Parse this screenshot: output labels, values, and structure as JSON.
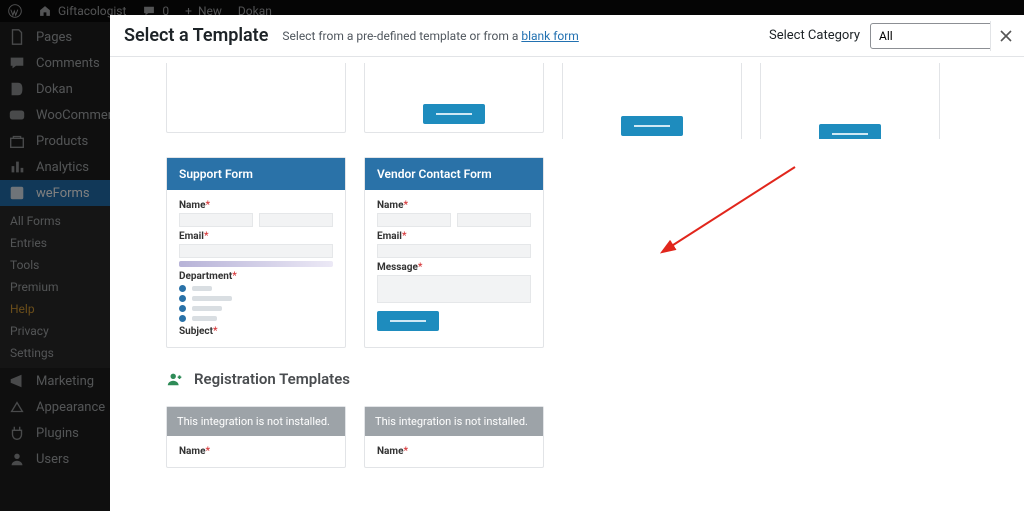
{
  "adminbar": {
    "site_name": "Giftacologist",
    "comments_count": "0",
    "new_label": "New",
    "dokan_label": "Dokan"
  },
  "sidebar": {
    "items": [
      {
        "label": "Pages",
        "icon": "pages"
      },
      {
        "label": "Comments",
        "icon": "comments"
      },
      {
        "label": "Dokan",
        "icon": "dokan"
      },
      {
        "label": "WooCommerce",
        "icon": "woo"
      },
      {
        "label": "Products",
        "icon": "products"
      },
      {
        "label": "Analytics",
        "icon": "analytics"
      },
      {
        "label": "weForms",
        "icon": "weforms"
      },
      {
        "label": "Marketing",
        "icon": "marketing"
      },
      {
        "label": "Appearance",
        "icon": "appearance"
      },
      {
        "label": "Plugins",
        "icon": "plugins"
      },
      {
        "label": "Users",
        "icon": "users"
      }
    ],
    "subitems": [
      {
        "label": "All Forms"
      },
      {
        "label": "Entries"
      },
      {
        "label": "Tools"
      },
      {
        "label": "Premium"
      },
      {
        "label": "Help",
        "help": true
      },
      {
        "label": "Privacy"
      },
      {
        "label": "Settings"
      }
    ]
  },
  "modal": {
    "title": "Select a Template",
    "subtitle_pre": "Select from a pre-defined template or from a ",
    "blank_link": "blank form",
    "category_label": "Select Category",
    "category_value": "All",
    "section_reg": "Registration Templates",
    "not_installed": "This integration is not installed."
  },
  "cards": {
    "support": {
      "title": "Support Form",
      "name_label": "Name",
      "email_label": "Email",
      "dept_label": "Department",
      "subject_label": "Subject"
    },
    "vendor": {
      "title": "Vendor Contact Form",
      "name_label": "Name",
      "email_label": "Email",
      "message_label": "Message"
    },
    "reg": {
      "name_label": "Name"
    }
  }
}
